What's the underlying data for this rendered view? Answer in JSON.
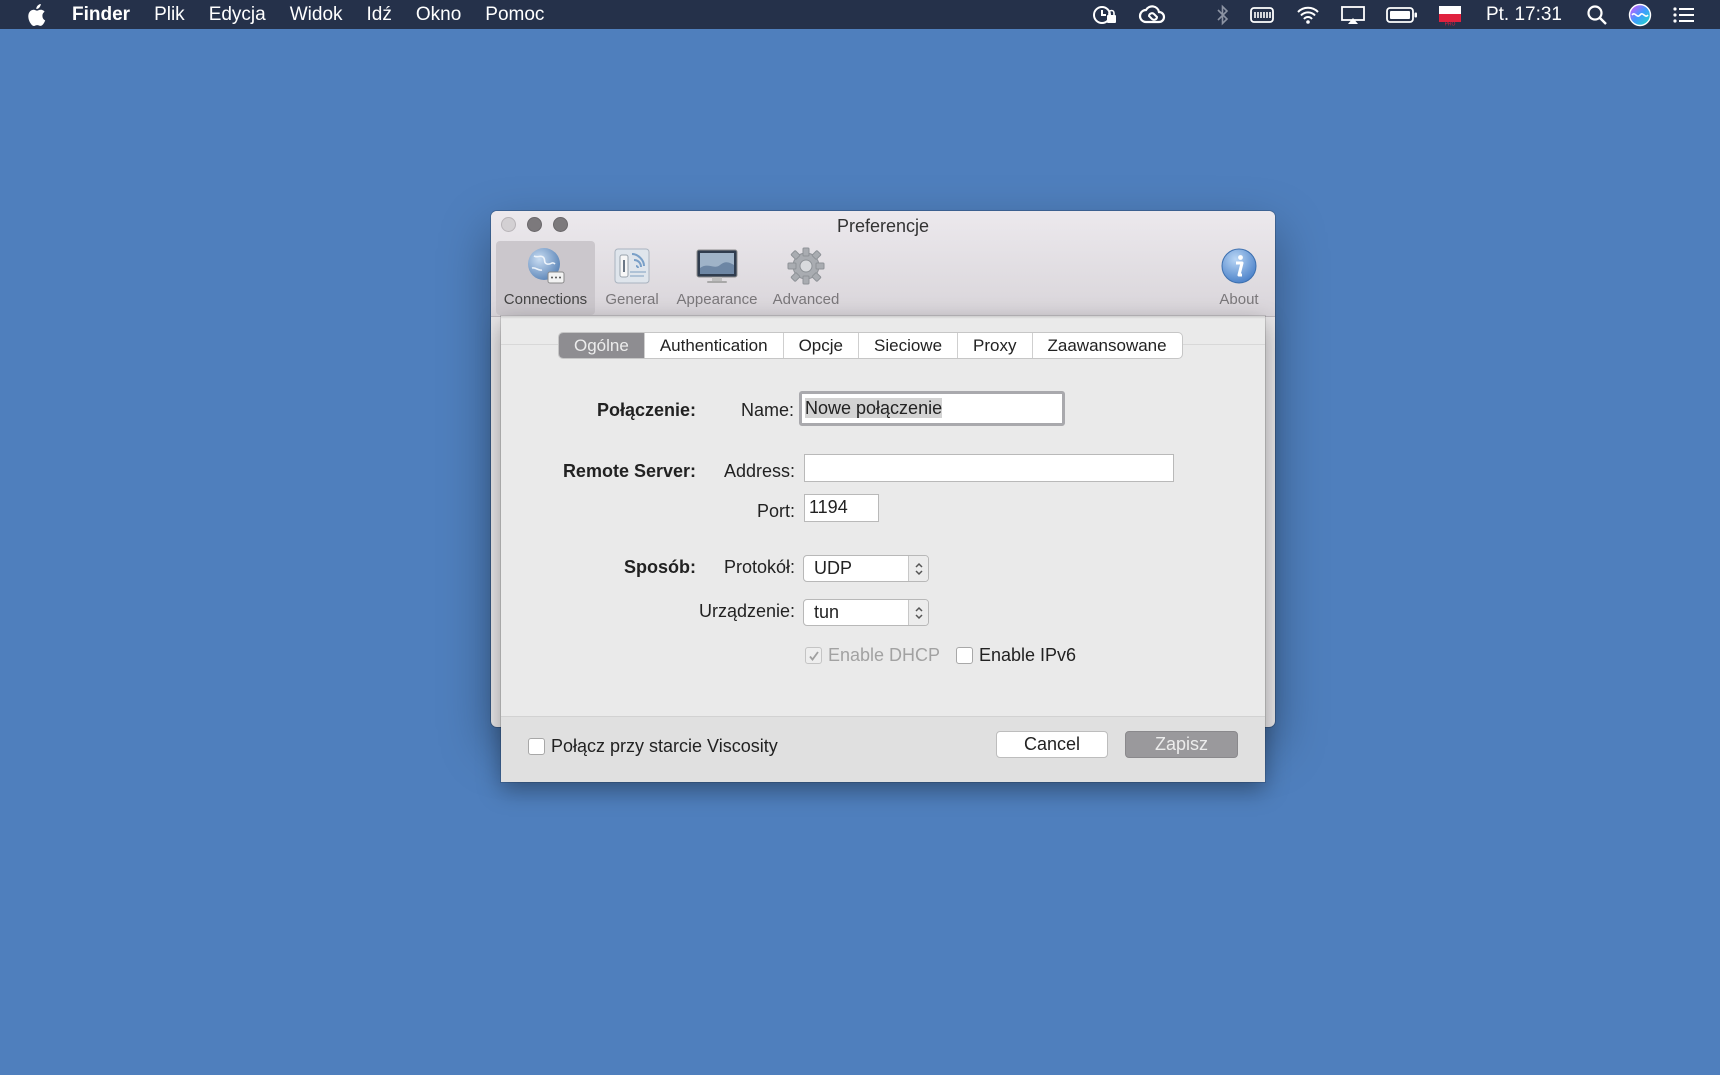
{
  "menubar": {
    "app_name": "Finder",
    "items": [
      "Plik",
      "Edycja",
      "Widok",
      "Idź",
      "Okno",
      "Pomoc"
    ],
    "clock": "Pt. 17:31",
    "status_icons": [
      "time-machine-lock-icon",
      "creative-cloud-icon",
      "bluetooth-icon",
      "battery-meter-icon",
      "wifi-icon",
      "airplay-icon",
      "battery-icon",
      "flag-pl-icon",
      "spotlight-search-icon",
      "siri-icon",
      "notification-center-icon"
    ]
  },
  "window": {
    "title": "Preferencje",
    "toolbar": [
      {
        "label": "Connections",
        "icon": "connections-globe-icon",
        "selected": true
      },
      {
        "label": "General",
        "icon": "general-switch-icon",
        "selected": false
      },
      {
        "label": "Appearance",
        "icon": "appearance-monitor-icon",
        "selected": false
      },
      {
        "label": "Advanced",
        "icon": "advanced-gear-icon",
        "selected": false
      },
      {
        "label": "About",
        "icon": "about-info-icon",
        "selected": false
      }
    ]
  },
  "sheet": {
    "tabs": [
      "Ogólne",
      "Authentication",
      "Opcje",
      "Sieciowe",
      "Proxy",
      "Zaawansowane"
    ],
    "active_tab": "Ogólne",
    "connection": {
      "section_label": "Połączenie:",
      "name_label": "Name:",
      "name_value": "Nowe połączenie"
    },
    "remote_server": {
      "section_label": "Remote Server:",
      "address_label": "Address:",
      "address_value": "",
      "port_label": "Port:",
      "port_value": "1194"
    },
    "method": {
      "section_label": "Sposób:",
      "protocol_label": "Protokół:",
      "protocol_value": "UDP",
      "device_label": "Urządzenie:",
      "device_value": "tun"
    },
    "options": {
      "dhcp_label": "Enable DHCP",
      "dhcp_checked": true,
      "dhcp_disabled": true,
      "ipv6_label": "Enable IPv6",
      "ipv6_checked": false
    },
    "footer": {
      "autoconnect_label": "Połącz przy starcie Viscosity",
      "autoconnect_checked": false,
      "cancel_label": "Cancel",
      "save_label": "Zapisz"
    }
  },
  "colors": {
    "desktop": "#4f7fbd",
    "menubar": "#25314a",
    "active_segment": "#8e8d91"
  }
}
